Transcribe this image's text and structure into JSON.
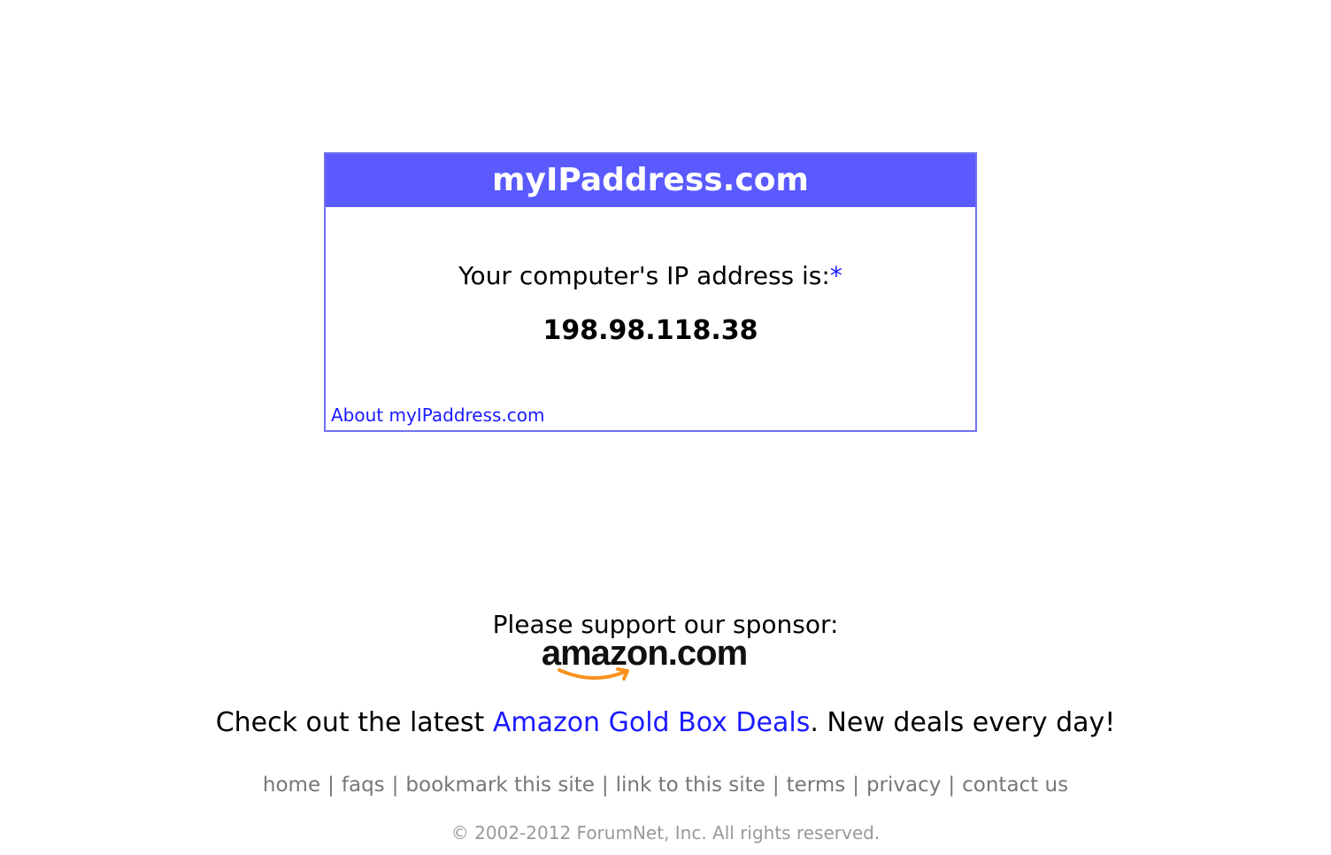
{
  "ip_box": {
    "title": "myIPaddress.com",
    "label": "Your computer's IP address is:",
    "asterisk": "*",
    "ip_address": "198.98.118.38",
    "about_link": "About myIPaddress.com"
  },
  "sponsor": {
    "text": "Please support our sponsor:",
    "logo_text": "amazon.com",
    "logo_icon": "amazon-logo"
  },
  "deals": {
    "prefix": "Check out the latest ",
    "link": "Amazon Gold Box Deals",
    "suffix": ". New deals every day!"
  },
  "footer": {
    "links": [
      "home",
      "faqs",
      "bookmark this site",
      "link to this site",
      "terms",
      "privacy",
      "contact us"
    ],
    "separator": "|",
    "copyright": "© 2002-2012 ForumNet, Inc. All rights reserved."
  },
  "colors": {
    "header_bg": "#5a5aff",
    "box_border": "#7070f0",
    "link": "#1a1aff",
    "footer_text": "#777777",
    "amazon_orange": "#f7931e"
  }
}
